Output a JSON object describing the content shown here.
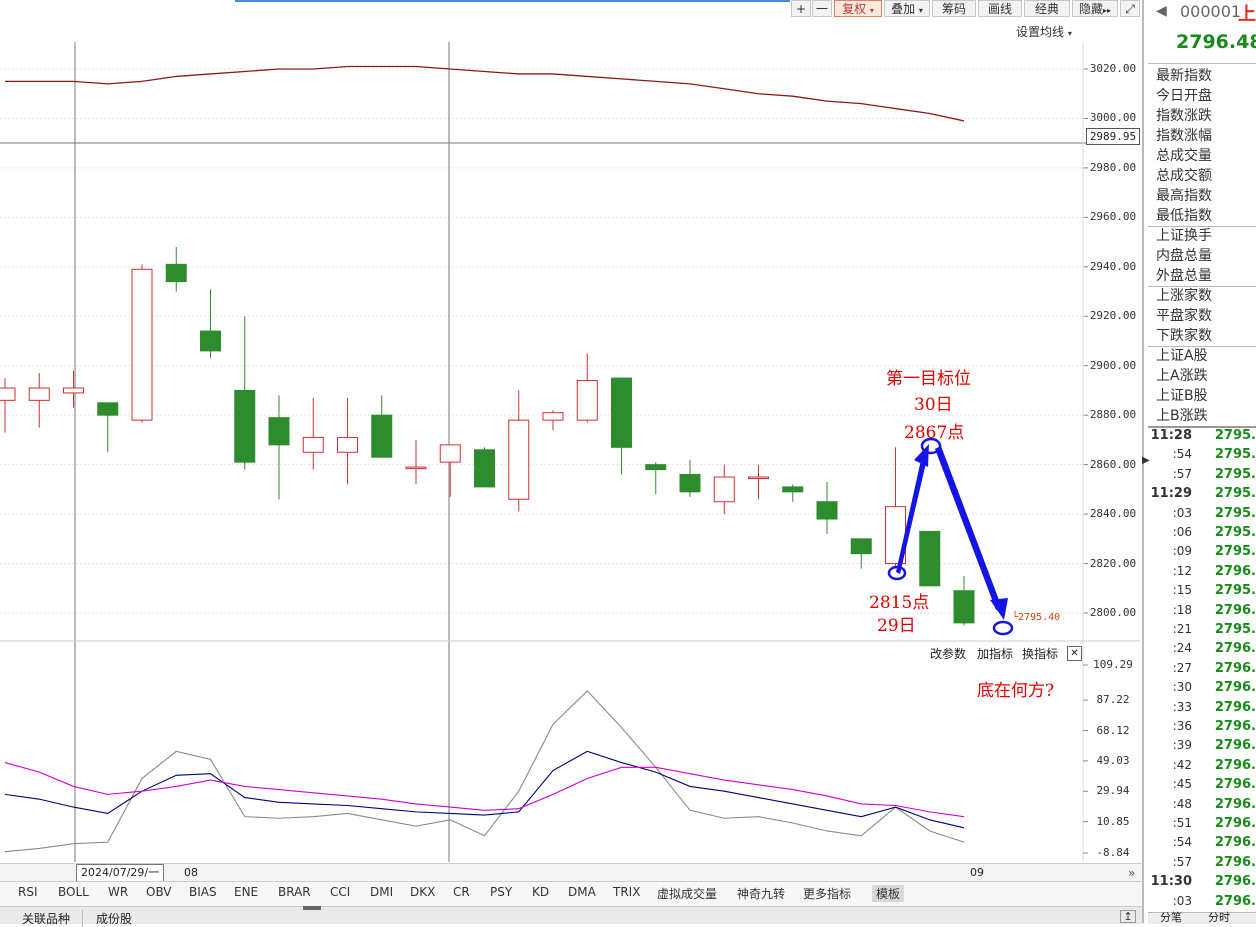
{
  "toolbar": {
    "plus": "+",
    "minus": "一",
    "fuquan": "复权",
    "diejia": "叠加",
    "chouma": "筹码",
    "huixian": "画线",
    "jingdian": "经典",
    "yincang": "隐藏"
  },
  "main_chart": {
    "ma_setting_label": "设置均线",
    "price_ticks": [
      "3020.00",
      "3000.00",
      "2980.00",
      "2960.00",
      "2940.00",
      "2920.00",
      "2900.00",
      "2880.00",
      "2860.00",
      "2840.00",
      "2820.00",
      "2800.00"
    ],
    "crosshair_price": "2989.95",
    "last_price_label": "2795.40"
  },
  "chart_data": {
    "type": "candlestick",
    "ylim": [
      2790,
      3032
    ],
    "candles": [
      {
        "o": 2886,
        "h": 2895,
        "l": 2873,
        "c": 2891
      },
      {
        "o": 2886,
        "h": 2897,
        "l": 2875,
        "c": 2891
      },
      {
        "o": 2889,
        "h": 2898,
        "l": 2883,
        "c": 2891
      },
      {
        "o": 2885,
        "h": 2885,
        "l": 2865,
        "c": 2880
      },
      {
        "o": 2878,
        "h": 2941,
        "l": 2877,
        "c": 2939
      },
      {
        "o": 2941,
        "h": 2948,
        "l": 2930,
        "c": 2934
      },
      {
        "o": 2914,
        "h": 2931,
        "l": 2903,
        "c": 2906
      },
      {
        "o": 2890,
        "h": 2920,
        "l": 2858,
        "c": 2861
      },
      {
        "o": 2879,
        "h": 2888,
        "l": 2846,
        "c": 2868
      },
      {
        "o": 2865,
        "h": 2887,
        "l": 2858,
        "c": 2871
      },
      {
        "o": 2865,
        "h": 2887,
        "l": 2852,
        "c": 2871
      },
      {
        "o": 2880,
        "h": 2888,
        "l": 2863,
        "c": 2863
      },
      {
        "o": 2859,
        "h": 2870,
        "l": 2852,
        "c": 2859
      },
      {
        "o": 2861,
        "h": 2868,
        "l": 2847,
        "c": 2868
      },
      {
        "o": 2866,
        "h": 2867,
        "l": 2851,
        "c": 2851
      },
      {
        "o": 2846,
        "h": 2890,
        "l": 2841,
        "c": 2878
      },
      {
        "o": 2878,
        "h": 2882,
        "l": 2874,
        "c": 2881
      },
      {
        "o": 2878,
        "h": 2905,
        "l": 2877,
        "c": 2894
      },
      {
        "o": 2895,
        "h": 2895,
        "l": 2856,
        "c": 2867
      },
      {
        "o": 2860,
        "h": 2861,
        "l": 2848,
        "c": 2858
      },
      {
        "o": 2856,
        "h": 2862,
        "l": 2847,
        "c": 2849
      },
      {
        "o": 2845,
        "h": 2860,
        "l": 2840,
        "c": 2855
      },
      {
        "o": 2855,
        "h": 2860,
        "l": 2846,
        "c": 2855
      },
      {
        "o": 2851,
        "h": 2852,
        "l": 2845,
        "c": 2849
      },
      {
        "o": 2845,
        "h": 2853,
        "l": 2832,
        "c": 2838
      },
      {
        "o": 2830,
        "h": 2830,
        "l": 2818,
        "c": 2824
      },
      {
        "o": 2820,
        "h": 2867,
        "l": 2818,
        "c": 2843
      },
      {
        "o": 2833,
        "h": 2833,
        "l": 2811,
        "c": 2811
      },
      {
        "o": 2809,
        "h": 2815,
        "l": 2795,
        "c": 2796
      }
    ],
    "ma_line": [
      3015,
      3015,
      3015,
      3014,
      3015,
      3017,
      3018,
      3019,
      3020,
      3020,
      3021,
      3021,
      3021,
      3020,
      3019,
      3018,
      3018,
      3017,
      3016,
      3015,
      3014,
      3012,
      3010,
      3009,
      3007,
      3006,
      3004,
      3002,
      2999
    ],
    "indicator": {
      "ylim": [
        -12,
        112
      ],
      "ticks": [
        "109.29",
        "87.22",
        "68.12",
        "49.03",
        "29.94",
        "10.85",
        "-8.84"
      ],
      "series": [
        {
          "color": "#8a8a8a",
          "values": [
            -8,
            -6,
            -3,
            -2,
            38,
            55,
            50,
            14,
            13,
            14,
            16,
            12,
            8,
            12,
            2,
            30,
            72,
            93,
            70,
            45,
            18,
            13,
            14,
            10,
            5,
            2,
            20,
            5,
            -2
          ]
        },
        {
          "color": "#00007a",
          "values": [
            28,
            25,
            20,
            16,
            30,
            40,
            41,
            26,
            23,
            22,
            21,
            19,
            17,
            16,
            15,
            17,
            43,
            55,
            48,
            42,
            33,
            30,
            26,
            22,
            18,
            14,
            20,
            12,
            7
          ]
        },
        {
          "color": "#d000d0",
          "values": [
            48,
            42,
            33,
            28,
            30,
            33,
            37,
            33,
            31,
            29,
            27,
            25,
            22,
            20,
            18,
            19,
            28,
            38,
            45,
            45,
            41,
            37,
            34,
            31,
            27,
            22,
            21,
            17,
            14
          ]
        }
      ]
    }
  },
  "annotations": {
    "target_line1": "第一目标位",
    "target_line2": "30日",
    "target_price": "2867点",
    "low_price": "2815点",
    "low_day": "29日",
    "question": "底在何方?"
  },
  "indicator_panel": {
    "modify_params": "改参数",
    "add_indicator": "加指标",
    "switch_indicator": "换指标",
    "close": "✕"
  },
  "x_axis": {
    "date_label": "2024/07/29/一",
    "month_08": "08",
    "month_09": "09"
  },
  "indicator_tabs": [
    "RSI",
    "BOLL",
    "WR",
    "OBV",
    "BIAS",
    "ENE",
    "BRAR",
    "CCI",
    "DMI",
    "DKX",
    "CR",
    "PSY",
    "KD",
    "DMA",
    "TRIX",
    "虚拟成交量",
    "神奇九转",
    "更多指标",
    "模板"
  ],
  "bottom_tabs": [
    "关联品种",
    "成份股"
  ],
  "side_panel": {
    "code": "000001",
    "name_partial": "上",
    "price": "2796.48",
    "fields": [
      "最新指数",
      "今日开盘",
      "指数涨跌",
      "指数涨幅",
      "总成交量",
      "总成交额",
      "最高指数",
      "最低指数",
      "上证换手",
      "内盘总量",
      "外盘总量",
      "上涨家数",
      "平盘家数",
      "下跌家数",
      "上证A股",
      "上A涨跌",
      "上证B股",
      "上B涨跌"
    ],
    "ticks": [
      {
        "time": "11:28",
        "price": "2795."
      },
      {
        "time": ":54",
        "price": "2795."
      },
      {
        "time": ":57",
        "price": "2795."
      },
      {
        "time": "11:29",
        "price": "2795."
      },
      {
        "time": ":03",
        "price": "2795."
      },
      {
        "time": ":06",
        "price": "2795."
      },
      {
        "time": ":09",
        "price": "2795."
      },
      {
        "time": ":12",
        "price": "2796."
      },
      {
        "time": ":15",
        "price": "2795."
      },
      {
        "time": ":18",
        "price": "2796."
      },
      {
        "time": ":21",
        "price": "2795."
      },
      {
        "time": ":24",
        "price": "2796."
      },
      {
        "time": ":27",
        "price": "2796."
      },
      {
        "time": ":30",
        "price": "2796."
      },
      {
        "time": ":33",
        "price": "2796."
      },
      {
        "time": ":36",
        "price": "2796."
      },
      {
        "time": ":39",
        "price": "2796."
      },
      {
        "time": ":42",
        "price": "2796."
      },
      {
        "time": ":45",
        "price": "2796."
      },
      {
        "time": ":48",
        "price": "2796."
      },
      {
        "time": ":51",
        "price": "2796."
      },
      {
        "time": ":54",
        "price": "2796."
      },
      {
        "time": ":57",
        "price": "2796."
      },
      {
        "time": "11:30",
        "price": "2796."
      },
      {
        "time": ":03",
        "price": "2796."
      }
    ],
    "bottom_tabs": [
      "分笔",
      "分时"
    ]
  },
  "colors": {
    "up": "#d03030",
    "down": "#2e8b2e",
    "ma": "#8b1a1a",
    "annotation": "#e00000",
    "arrow": "#1414e6"
  }
}
